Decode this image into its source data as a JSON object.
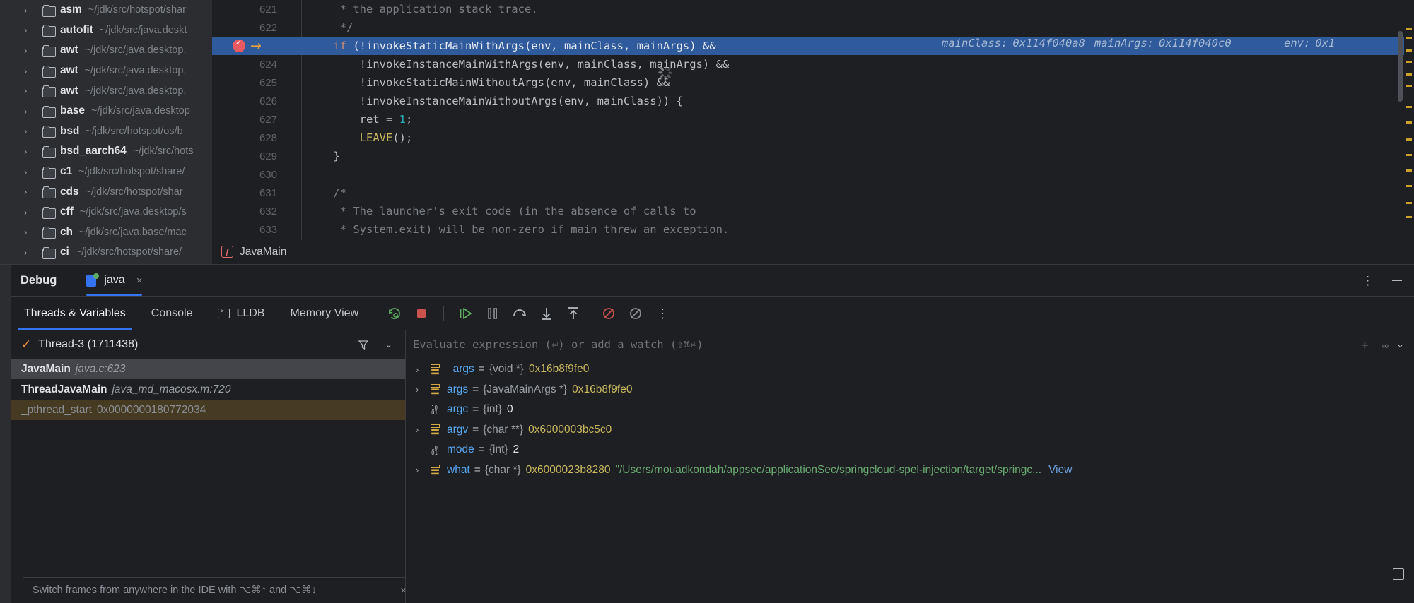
{
  "project_tree": {
    "items": [
      {
        "name": "asm",
        "path": "~/jdk/src/hotspot/shar"
      },
      {
        "name": "autofit",
        "path": "~/jdk/src/java.deskt"
      },
      {
        "name": "awt",
        "path": "~/jdk/src/java.desktop,"
      },
      {
        "name": "awt",
        "path": "~/jdk/src/java.desktop,"
      },
      {
        "name": "awt",
        "path": "~/jdk/src/java.desktop,"
      },
      {
        "name": "base",
        "path": "~/jdk/src/java.desktop"
      },
      {
        "name": "bsd",
        "path": "~/jdk/src/hotspot/os/b"
      },
      {
        "name": "bsd_aarch64",
        "path": "~/jdk/src/hots"
      },
      {
        "name": "c1",
        "path": "~/jdk/src/hotspot/share/"
      },
      {
        "name": "cds",
        "path": "~/jdk/src/hotspot/shar"
      },
      {
        "name": "cff",
        "path": "~/jdk/src/java.desktop/s"
      },
      {
        "name": "ch",
        "path": "~/jdk/src/java.base/mac"
      },
      {
        "name": "ci",
        "path": "~/jdk/src/hotspot/share/"
      }
    ]
  },
  "editor": {
    "lines": [
      {
        "no": "621",
        "text": "     * the application stack trace.",
        "kind": "comment"
      },
      {
        "no": "622",
        "text": "     */",
        "kind": "comment"
      },
      {
        "no": "623",
        "text": "    if (!invokeStaticMainWithArgs(env, mainClass, mainArgs) &&",
        "kind": "highlight",
        "breakpoint": true
      },
      {
        "no": "624",
        "text": "        !invokeInstanceMainWithArgs(env, mainClass, mainArgs) &&",
        "kind": "code"
      },
      {
        "no": "625",
        "text": "        !invokeStaticMainWithoutArgs(env, mainClass) &&",
        "kind": "code"
      },
      {
        "no": "626",
        "text": "        !invokeInstanceMainWithoutArgs(env, mainClass)) {",
        "kind": "code"
      },
      {
        "no": "627",
        "text": "        ret = 1;",
        "kind": "code"
      },
      {
        "no": "628",
        "text": "        LEAVE();",
        "kind": "code"
      },
      {
        "no": "629",
        "text": "    }",
        "kind": "code"
      },
      {
        "no": "630",
        "text": "",
        "kind": "code"
      },
      {
        "no": "631",
        "text": "    /*",
        "kind": "comment"
      },
      {
        "no": "632",
        "text": "     * The launcher's exit code (in the absence of calls to",
        "kind": "comment"
      },
      {
        "no": "633",
        "text": "     * System.exit) will be non-zero if main threw an exception.",
        "kind": "comment"
      }
    ],
    "inline_hints": [
      {
        "label": "mainClass:",
        "value": "0x114f040a8"
      },
      {
        "label": "mainArgs:",
        "value": "0x114f040c0"
      },
      {
        "label": "env:",
        "value": "0x1"
      }
    ],
    "breadcrumb": {
      "icon": "function-icon",
      "label": "JavaMain"
    }
  },
  "debug_panel": {
    "title": "Debug",
    "tab": {
      "label": "java",
      "close": "×"
    },
    "more_icon": "⋮",
    "toolbar_tabs": [
      {
        "label": "Threads & Variables",
        "active": true
      },
      {
        "label": "Console",
        "active": false
      },
      {
        "label": "LLDB",
        "active": false,
        "icon": "terminal-icon"
      },
      {
        "label": "Memory View",
        "active": false
      }
    ],
    "toolbar_actions": [
      "rerun-icon",
      "stop-icon",
      "resume-icon",
      "pause-icon",
      "step-over-icon",
      "step-into-icon",
      "step-out-icon",
      "mute-breakpoints-icon",
      "disable-breakpoints-icon",
      "more-actions-icon"
    ]
  },
  "frames": {
    "thread": "Thread-3 (1711438)",
    "thread_state_icon": "check-icon",
    "filter_icon": "filter-icon",
    "chevron_icon": "chevron-down-icon",
    "rows": [
      {
        "fn": "JavaMain",
        "loc": "java.c:623",
        "style": "selected"
      },
      {
        "fn": "ThreadJavaMain",
        "loc": "java_md_macosx.m:720",
        "style": "normal"
      },
      {
        "fn": "_pthread_start",
        "loc": "0x0000000180772034",
        "style": "warn"
      }
    ],
    "status": "Switch frames from anywhere in the IDE with ⌥⌘↑ and ⌥⌘↓",
    "status_close": "×"
  },
  "variables": {
    "evaluate_placeholder": "Evaluate expression (⏎) or add a watch (⇧⌘⏎)",
    "rows": [
      {
        "expandable": true,
        "icon": "pointer-icon",
        "name": "_args",
        "type": "{void *}",
        "value": "0x16b8f9fe0",
        "value_kind": "hex"
      },
      {
        "expandable": true,
        "icon": "pointer-icon",
        "name": "args",
        "type": "{JavaMainArgs *}",
        "value": "0x16b8f9fe0",
        "value_kind": "hex"
      },
      {
        "expandable": false,
        "icon": "int-icon",
        "name": "argc",
        "type": "{int}",
        "value": "0",
        "value_kind": "plain"
      },
      {
        "expandable": true,
        "icon": "pointer-icon",
        "name": "argv",
        "type": "{char **}",
        "value": "0x6000003bc5c0",
        "value_kind": "hex"
      },
      {
        "expandable": false,
        "icon": "int-icon",
        "name": "mode",
        "type": "{int}",
        "value": "2",
        "value_kind": "plain"
      },
      {
        "expandable": true,
        "icon": "pointer-icon",
        "name": "what",
        "type": "{char *}",
        "value": "0x6000023b8280",
        "value_kind": "hex",
        "string": "\"/Users/mouadkondah/appsec/applicationSec/springcloud-spel-injection/target/springc...",
        "link": "View"
      }
    ]
  },
  "colors": {
    "accent": "#3574f0",
    "highlight_row": "#2f5a9c",
    "breakpoint": "#eb5a60",
    "panel_bg": "#1e1f22",
    "sidebar_bg": "#2b2d30"
  }
}
